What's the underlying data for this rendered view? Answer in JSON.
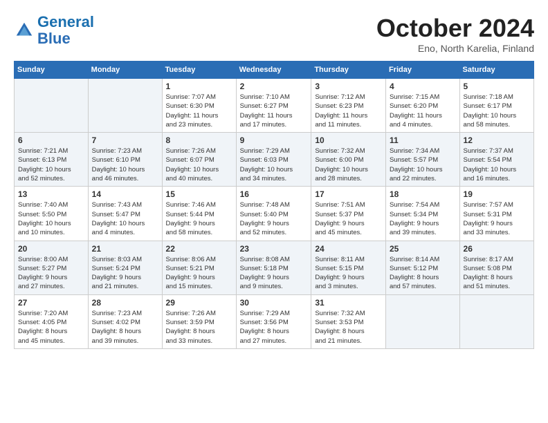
{
  "app": {
    "name": "GeneralBlue",
    "name_part1": "General",
    "name_part2": "Blue"
  },
  "calendar": {
    "month": "October 2024",
    "location": "Eno, North Karelia, Finland",
    "days_of_week": [
      "Sunday",
      "Monday",
      "Tuesday",
      "Wednesday",
      "Thursday",
      "Friday",
      "Saturday"
    ],
    "weeks": [
      [
        {
          "day": "",
          "detail": ""
        },
        {
          "day": "",
          "detail": ""
        },
        {
          "day": "1",
          "detail": "Sunrise: 7:07 AM\nSunset: 6:30 PM\nDaylight: 11 hours\nand 23 minutes."
        },
        {
          "day": "2",
          "detail": "Sunrise: 7:10 AM\nSunset: 6:27 PM\nDaylight: 11 hours\nand 17 minutes."
        },
        {
          "day": "3",
          "detail": "Sunrise: 7:12 AM\nSunset: 6:23 PM\nDaylight: 11 hours\nand 11 minutes."
        },
        {
          "day": "4",
          "detail": "Sunrise: 7:15 AM\nSunset: 6:20 PM\nDaylight: 11 hours\nand 4 minutes."
        },
        {
          "day": "5",
          "detail": "Sunrise: 7:18 AM\nSunset: 6:17 PM\nDaylight: 10 hours\nand 58 minutes."
        }
      ],
      [
        {
          "day": "6",
          "detail": "Sunrise: 7:21 AM\nSunset: 6:13 PM\nDaylight: 10 hours\nand 52 minutes."
        },
        {
          "day": "7",
          "detail": "Sunrise: 7:23 AM\nSunset: 6:10 PM\nDaylight: 10 hours\nand 46 minutes."
        },
        {
          "day": "8",
          "detail": "Sunrise: 7:26 AM\nSunset: 6:07 PM\nDaylight: 10 hours\nand 40 minutes."
        },
        {
          "day": "9",
          "detail": "Sunrise: 7:29 AM\nSunset: 6:03 PM\nDaylight: 10 hours\nand 34 minutes."
        },
        {
          "day": "10",
          "detail": "Sunrise: 7:32 AM\nSunset: 6:00 PM\nDaylight: 10 hours\nand 28 minutes."
        },
        {
          "day": "11",
          "detail": "Sunrise: 7:34 AM\nSunset: 5:57 PM\nDaylight: 10 hours\nand 22 minutes."
        },
        {
          "day": "12",
          "detail": "Sunrise: 7:37 AM\nSunset: 5:54 PM\nDaylight: 10 hours\nand 16 minutes."
        }
      ],
      [
        {
          "day": "13",
          "detail": "Sunrise: 7:40 AM\nSunset: 5:50 PM\nDaylight: 10 hours\nand 10 minutes."
        },
        {
          "day": "14",
          "detail": "Sunrise: 7:43 AM\nSunset: 5:47 PM\nDaylight: 10 hours\nand 4 minutes."
        },
        {
          "day": "15",
          "detail": "Sunrise: 7:46 AM\nSunset: 5:44 PM\nDaylight: 9 hours\nand 58 minutes."
        },
        {
          "day": "16",
          "detail": "Sunrise: 7:48 AM\nSunset: 5:40 PM\nDaylight: 9 hours\nand 52 minutes."
        },
        {
          "day": "17",
          "detail": "Sunrise: 7:51 AM\nSunset: 5:37 PM\nDaylight: 9 hours\nand 45 minutes."
        },
        {
          "day": "18",
          "detail": "Sunrise: 7:54 AM\nSunset: 5:34 PM\nDaylight: 9 hours\nand 39 minutes."
        },
        {
          "day": "19",
          "detail": "Sunrise: 7:57 AM\nSunset: 5:31 PM\nDaylight: 9 hours\nand 33 minutes."
        }
      ],
      [
        {
          "day": "20",
          "detail": "Sunrise: 8:00 AM\nSunset: 5:27 PM\nDaylight: 9 hours\nand 27 minutes."
        },
        {
          "day": "21",
          "detail": "Sunrise: 8:03 AM\nSunset: 5:24 PM\nDaylight: 9 hours\nand 21 minutes."
        },
        {
          "day": "22",
          "detail": "Sunrise: 8:06 AM\nSunset: 5:21 PM\nDaylight: 9 hours\nand 15 minutes."
        },
        {
          "day": "23",
          "detail": "Sunrise: 8:08 AM\nSunset: 5:18 PM\nDaylight: 9 hours\nand 9 minutes."
        },
        {
          "day": "24",
          "detail": "Sunrise: 8:11 AM\nSunset: 5:15 PM\nDaylight: 9 hours\nand 3 minutes."
        },
        {
          "day": "25",
          "detail": "Sunrise: 8:14 AM\nSunset: 5:12 PM\nDaylight: 8 hours\nand 57 minutes."
        },
        {
          "day": "26",
          "detail": "Sunrise: 8:17 AM\nSunset: 5:08 PM\nDaylight: 8 hours\nand 51 minutes."
        }
      ],
      [
        {
          "day": "27",
          "detail": "Sunrise: 7:20 AM\nSunset: 4:05 PM\nDaylight: 8 hours\nand 45 minutes."
        },
        {
          "day": "28",
          "detail": "Sunrise: 7:23 AM\nSunset: 4:02 PM\nDaylight: 8 hours\nand 39 minutes."
        },
        {
          "day": "29",
          "detail": "Sunrise: 7:26 AM\nSunset: 3:59 PM\nDaylight: 8 hours\nand 33 minutes."
        },
        {
          "day": "30",
          "detail": "Sunrise: 7:29 AM\nSunset: 3:56 PM\nDaylight: 8 hours\nand 27 minutes."
        },
        {
          "day": "31",
          "detail": "Sunrise: 7:32 AM\nSunset: 3:53 PM\nDaylight: 8 hours\nand 21 minutes."
        },
        {
          "day": "",
          "detail": ""
        },
        {
          "day": "",
          "detail": ""
        }
      ]
    ]
  }
}
